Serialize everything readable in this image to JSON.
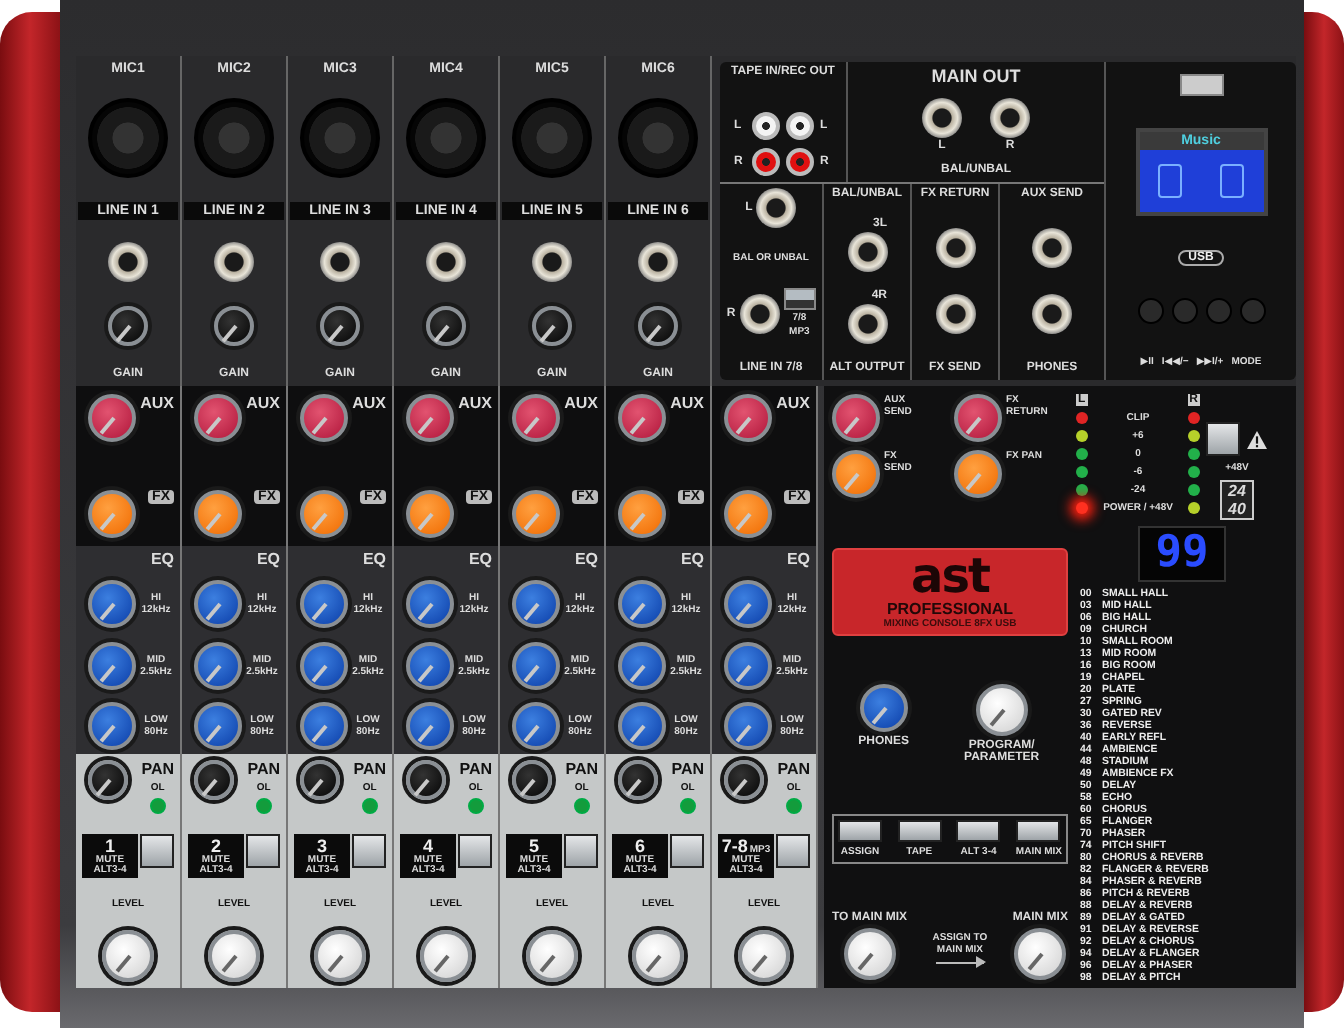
{
  "inputs": [
    {
      "mic": "MIC1",
      "line": "LINE IN 1",
      "gain": "GAIN"
    },
    {
      "mic": "MIC2",
      "line": "LINE IN 2",
      "gain": "GAIN"
    },
    {
      "mic": "MIC3",
      "line": "LINE IN 3",
      "gain": "GAIN"
    },
    {
      "mic": "MIC4",
      "line": "LINE IN 4",
      "gain": "GAIN"
    },
    {
      "mic": "MIC5",
      "line": "LINE IN 5",
      "gain": "GAIN"
    },
    {
      "mic": "MIC6",
      "line": "LINE IN 6",
      "gain": "GAIN"
    }
  ],
  "rear_panel": {
    "tape": {
      "title": "TAPE IN/REC OUT",
      "labels": [
        "L",
        "L",
        "R",
        "R"
      ]
    },
    "main_out": {
      "title": "MAIN OUT",
      "jacks": [
        "L",
        "R"
      ],
      "footer": "BAL/UNBAL"
    },
    "line_in": {
      "jacks": [
        "L",
        "R"
      ],
      "note": "BAL OR UNBAL",
      "switch": [
        "7/8",
        "MP3"
      ],
      "switch_up": true,
      "footer": "LINE IN 7/8"
    },
    "alt_output": {
      "title": "BAL/UNBAL",
      "jacks": [
        "3L",
        "4R"
      ],
      "footer": "ALT OUTPUT"
    },
    "fx": {
      "title": "FX RETURN",
      "footer": "FX SEND"
    },
    "aux": {
      "title": "AUX SEND",
      "footer": "PHONES"
    }
  },
  "usb_player": {
    "screen_title": "Music",
    "badge": "USB",
    "buttons": [
      "▶II",
      "I◀◀/−",
      "▶▶I/+",
      "MODE"
    ]
  },
  "strips": [
    {
      "number": "1",
      "aux": "AUX",
      "fx": "FX",
      "eq": "EQ",
      "hi": "HI 12kHz",
      "mid": "MID 2.5kHz",
      "low": "LOW 80Hz",
      "pan": "PAN",
      "ol": "OL",
      "mute": "MUTE ALT3-4",
      "level": "LEVEL"
    },
    {
      "number": "2",
      "aux": "AUX",
      "fx": "FX",
      "eq": "EQ",
      "hi": "HI 12kHz",
      "mid": "MID 2.5kHz",
      "low": "LOW 80Hz",
      "pan": "PAN",
      "ol": "OL",
      "mute": "MUTE ALT3-4",
      "level": "LEVEL"
    },
    {
      "number": "3",
      "aux": "AUX",
      "fx": "FX",
      "eq": "EQ",
      "hi": "HI 12kHz",
      "mid": "MID 2.5kHz",
      "low": "LOW 80Hz",
      "pan": "PAN",
      "ol": "OL",
      "mute": "MUTE ALT3-4",
      "level": "LEVEL"
    },
    {
      "number": "4",
      "aux": "AUX",
      "fx": "FX",
      "eq": "EQ",
      "hi": "HI 12kHz",
      "mid": "MID 2.5kHz",
      "low": "LOW 80Hz",
      "pan": "PAN",
      "ol": "OL",
      "mute": "MUTE ALT3-4",
      "level": "LEVEL"
    },
    {
      "number": "5",
      "aux": "AUX",
      "fx": "FX",
      "eq": "EQ",
      "hi": "HI 12kHz",
      "mid": "MID 2.5kHz",
      "low": "LOW 80Hz",
      "pan": "PAN",
      "ol": "OL",
      "mute": "MUTE ALT3-4",
      "level": "LEVEL"
    },
    {
      "number": "6",
      "aux": "AUX",
      "fx": "FX",
      "eq": "EQ",
      "hi": "HI 12kHz",
      "mid": "MID 2.5kHz",
      "low": "LOW 80Hz",
      "pan": "PAN",
      "ol": "OL",
      "mute": "MUTE ALT3-4",
      "level": "LEVEL"
    },
    {
      "number": "7-8",
      "suffix": "MP3",
      "aux": "AUX",
      "fx": "FX",
      "eq": "EQ",
      "hi": "HI 12kHz",
      "mid": "MID 2.5kHz",
      "low": "LOW 80Hz",
      "pan": "PAN",
      "ol": "OL",
      "mute": "MUTE ALT3-4",
      "level": "LEVEL"
    }
  ],
  "master": {
    "knobs": [
      {
        "label": "AUX SEND",
        "kind": "red"
      },
      {
        "label": "FX RETURN",
        "kind": "red"
      },
      {
        "label": "FX SEND",
        "kind": "orange"
      },
      {
        "label": "FX PAN",
        "kind": "orange"
      }
    ],
    "meter": {
      "left": "L",
      "right": "R",
      "rows": [
        {
          "label": "CLIP",
          "color": "#e02424"
        },
        {
          "label": "+6",
          "color": "#b6d02a"
        },
        {
          "label": "0",
          "color": "#22b04a"
        },
        {
          "label": "-6",
          "color": "#22b04a"
        },
        {
          "label": "-24",
          "color": "#22b04a"
        }
      ],
      "power": {
        "label": "POWER / +48V",
        "lit": true,
        "color": "#b6d02a"
      }
    },
    "phantom": "+48V",
    "badge": [
      "24",
      "40"
    ],
    "logo": {
      "mark": "ast",
      "title": "PROFESSIONAL",
      "subtitle": "MIXING CONSOLE 8FX USB"
    },
    "display": "99",
    "effects": [
      {
        "number": "00",
        "name": "SMALL HALL"
      },
      {
        "number": "03",
        "name": "MID HALL"
      },
      {
        "number": "06",
        "name": "BIG HALL"
      },
      {
        "number": "09",
        "name": "CHURCH"
      },
      {
        "number": "10",
        "name": "SMALL ROOM"
      },
      {
        "number": "13",
        "name": "MID ROOM"
      },
      {
        "number": "16",
        "name": "BIG ROOM"
      },
      {
        "number": "19",
        "name": "CHAPEL"
      },
      {
        "number": "20",
        "name": "PLATE"
      },
      {
        "number": "27",
        "name": "SPRING"
      },
      {
        "number": "30",
        "name": "GATED REV"
      },
      {
        "number": "36",
        "name": "REVERSE"
      },
      {
        "number": "40",
        "name": "EARLY REFL"
      },
      {
        "number": "44",
        "name": "AMBIENCE"
      },
      {
        "number": "48",
        "name": "STADIUM"
      },
      {
        "number": "49",
        "name": "AMBIENCE FX"
      },
      {
        "number": "50",
        "name": "DELAY"
      },
      {
        "number": "58",
        "name": "ECHO"
      },
      {
        "number": "60",
        "name": "CHORUS"
      },
      {
        "number": "65",
        "name": "FLANGER"
      },
      {
        "number": "70",
        "name": "PHASER"
      },
      {
        "number": "74",
        "name": "PITCH SHIFT"
      },
      {
        "number": "80",
        "name": "CHORUS & REVERB"
      },
      {
        "number": "82",
        "name": "FLANGER & REVERB"
      },
      {
        "number": "84",
        "name": "PHASER & REVERB"
      },
      {
        "number": "86",
        "name": "PITCH & REVERB"
      },
      {
        "number": "88",
        "name": "DELAY & REVERB"
      },
      {
        "number": "89",
        "name": "DELAY & GATED"
      },
      {
        "number": "91",
        "name": "DELAY & REVERSE"
      },
      {
        "number": "92",
        "name": "DELAY & CHORUS"
      },
      {
        "number": "94",
        "name": "DELAY & FLANGER"
      },
      {
        "number": "96",
        "name": "DELAY & PHASER"
      },
      {
        "number": "98",
        "name": "DELAY & PITCH"
      }
    ],
    "phones": "PHONES",
    "program": "PROGRAM/ PARAMETER",
    "assign_buttons": [
      "ASSIGN",
      "TAPE",
      "ALT 3-4",
      "MAIN MIX"
    ],
    "to_main_mix": "TO MAIN MIX",
    "assign_note": "ASSIGN TO MAIN MIX",
    "main_mix": "MAIN MIX"
  }
}
